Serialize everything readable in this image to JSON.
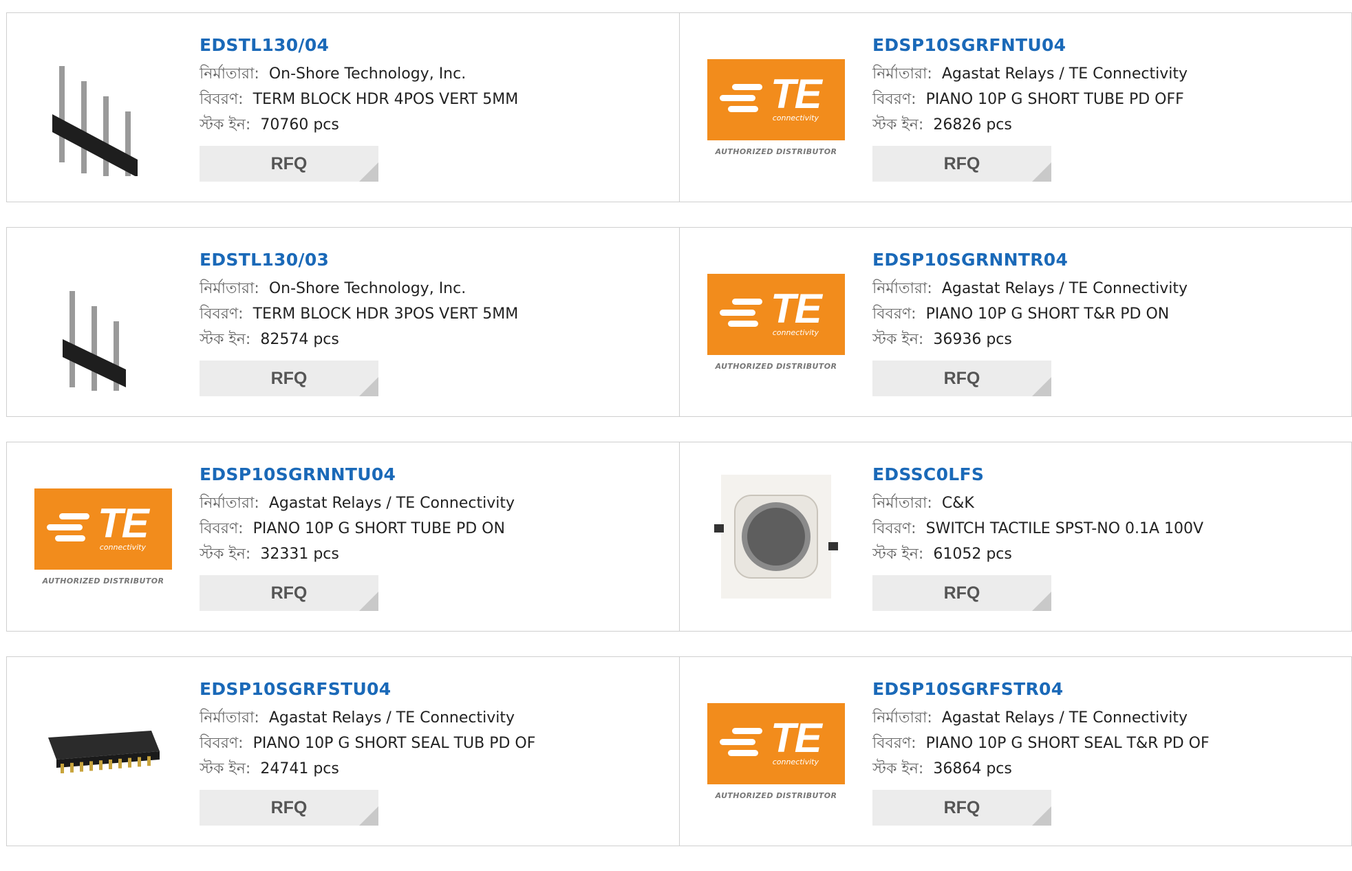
{
  "labels": {
    "manufacturer": "নির্মাতারা:",
    "description": "বিবরণ:",
    "stock": "স্টক ইন:",
    "rfq": "RFQ"
  },
  "products": [
    {
      "part": "EDSTL130/04",
      "manufacturer": "On-Shore Technology, Inc.",
      "description": "TERM BLOCK HDR 4POS VERT 5MM",
      "stock": "70760 pcs",
      "image": "header-4pin"
    },
    {
      "part": "EDSP10SGRFNTU04",
      "manufacturer": "Agastat Relays / TE Connectivity",
      "description": "PIANO 10P G SHORT TUBE PD OFF",
      "stock": "26826 pcs",
      "image": "te-logo"
    },
    {
      "part": "EDSTL130/03",
      "manufacturer": "On-Shore Technology, Inc.",
      "description": "TERM BLOCK HDR 3POS VERT 5MM",
      "stock": "82574 pcs",
      "image": "header-3pin"
    },
    {
      "part": "EDSP10SGRNNTR04",
      "manufacturer": "Agastat Relays / TE Connectivity",
      "description": "PIANO 10P G SHORT T&R PD ON",
      "stock": "36936 pcs",
      "image": "te-logo"
    },
    {
      "part": "EDSP10SGRNNTU04",
      "manufacturer": "Agastat Relays / TE Connectivity",
      "description": "PIANO 10P G SHORT TUBE PD ON",
      "stock": "32331 pcs",
      "image": "te-logo"
    },
    {
      "part": "EDSSC0LFS",
      "manufacturer": "C&K",
      "description": "SWITCH TACTILE SPST-NO 0.1A 100V",
      "stock": "61052 pcs",
      "image": "tactile-switch"
    },
    {
      "part": "EDSP10SGRFSTU04",
      "manufacturer": "Agastat Relays / TE Connectivity",
      "description": "PIANO 10P G SHORT SEAL TUB PD OF",
      "stock": "24741 pcs",
      "image": "dip-switch"
    },
    {
      "part": "EDSP10SGRFSTR04",
      "manufacturer": "Agastat Relays / TE Connectivity",
      "description": "PIANO 10P G SHORT SEAL T&R PD OF",
      "stock": "36864 pcs",
      "image": "te-logo"
    }
  ],
  "te_logo": {
    "text": "TE",
    "sub": "connectivity",
    "authorized": "AUTHORIZED DISTRIBUTOR",
    "color": "#f28c1c"
  },
  "colors": {
    "part_link": "#1a69b8",
    "rfq_bg": "#ececec",
    "border": "#cfcfcf"
  }
}
